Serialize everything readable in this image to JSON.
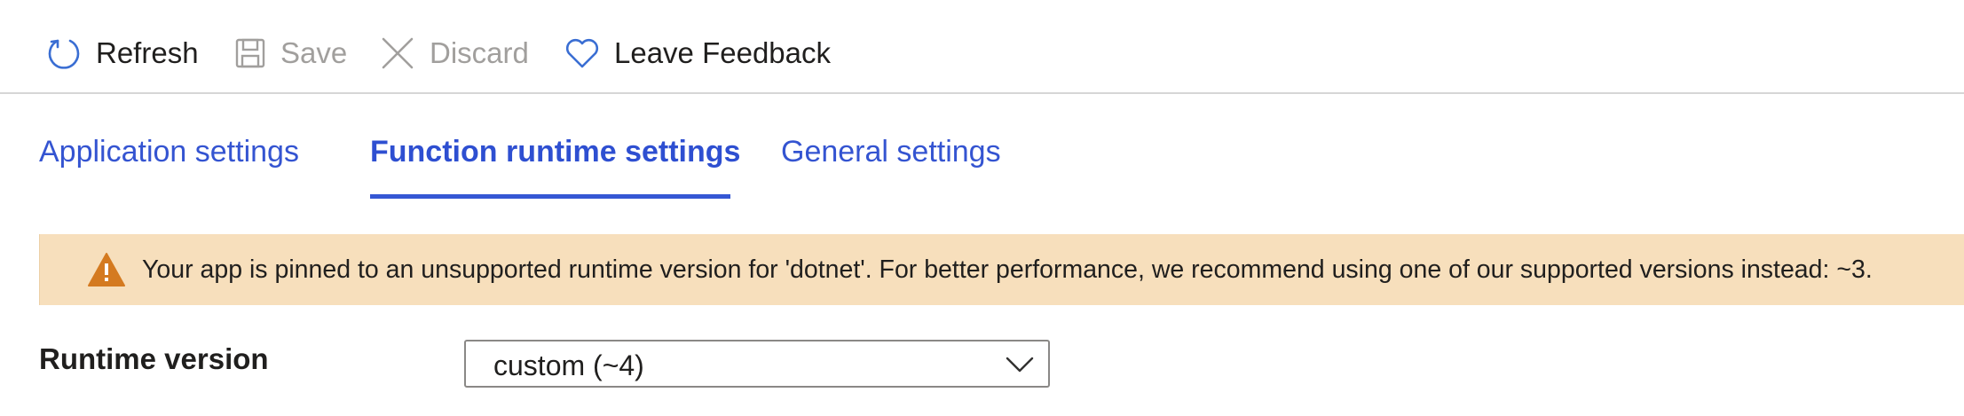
{
  "toolbar": {
    "refresh_label": "Refresh",
    "save_label": "Save",
    "discard_label": "Discard",
    "feedback_label": "Leave Feedback"
  },
  "tabs": [
    {
      "label": "Application settings",
      "active": false
    },
    {
      "label": "Function runtime settings",
      "active": true
    },
    {
      "label": "General settings",
      "active": false
    }
  ],
  "warning_banner": {
    "icon": "warning-icon",
    "message": "Your app is pinned to an unsupported runtime version for 'dotnet'. For better performance, we recommend using one of our supported versions instead: ~3."
  },
  "runtime_version": {
    "label": "Runtime version",
    "selected": "custom (~4)"
  },
  "colors": {
    "accent": "#3454d1",
    "banner_bg": "#f7dfbc",
    "warning_icon": "#d47a20",
    "disabled_text": "#a19f9d"
  }
}
